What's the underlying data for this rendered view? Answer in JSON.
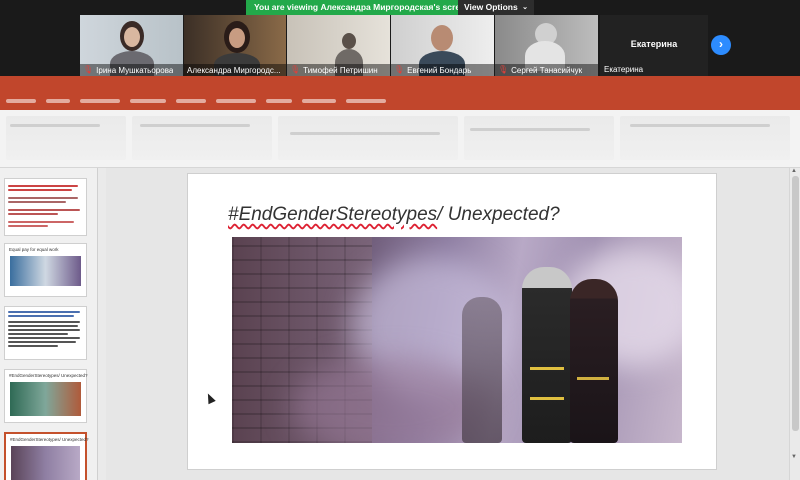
{
  "banner": {
    "viewing_text": "You are viewing Александра Миргородская's screen",
    "view_options_label": "View Options"
  },
  "participants": [
    {
      "name": "Ірина Мушкатьорова",
      "muted": true
    },
    {
      "name": "Александра Миргородс...",
      "muted": false,
      "active": true
    },
    {
      "name": "Тимофей Петришин",
      "muted": true
    },
    {
      "name": "Евгений Бондарь",
      "muted": true
    },
    {
      "name": "Сергей Танасийчук",
      "muted": true
    }
  ],
  "katerina": {
    "big_name": "Екатерина",
    "small_name": "Екатерина"
  },
  "slide": {
    "title_hash": "#EndGenderStereotypes",
    "title_rest": "/ Unexpected?"
  },
  "thumbnails": [
    {
      "title": ""
    },
    {
      "title": "Equal pay for equal work"
    },
    {
      "title": ""
    },
    {
      "title": "#EndGenderStereotypes/ Unexpected?"
    },
    {
      "title": "#EndGenderStereotypes/ Unexpected?",
      "selected": true
    }
  ],
  "colors": {
    "zoom_green": "#23a94a",
    "ppt_accent": "#c1462c",
    "active_speaker": "#e6d24a",
    "zoom_blue": "#2d8cff"
  }
}
